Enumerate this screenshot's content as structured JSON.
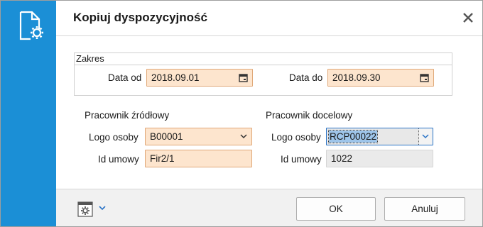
{
  "dialog": {
    "title": "Kopiuj dyspozycyjność",
    "icon": "document-gear-icon",
    "close_icon": "close-icon"
  },
  "zakres": {
    "title": "Zakres",
    "data_od_label": "Data od",
    "data_od_value": "2018.09.01",
    "data_do_label": "Data do",
    "data_do_value": "2018.09.30"
  },
  "zrodlowy": {
    "header": "Pracownik źródłowy",
    "logo_label": "Logo osoby",
    "logo_value": "B00001",
    "umowa_label": "Id umowy",
    "umowa_value": "Fir2/1"
  },
  "docelowy": {
    "header": "Pracownik docelowy",
    "logo_label": "Logo osoby",
    "logo_value": "RCP00022",
    "umowa_label": "Id umowy",
    "umowa_value": "1022"
  },
  "footer": {
    "ok_label": "OK",
    "cancel_label": "Anuluj"
  },
  "colors": {
    "sidebar": "#1b8fd6",
    "field_bg": "#fde5ce",
    "field_border": "#e0a878",
    "focus_border": "#2b74c7",
    "selection": "#9ec5ea"
  }
}
